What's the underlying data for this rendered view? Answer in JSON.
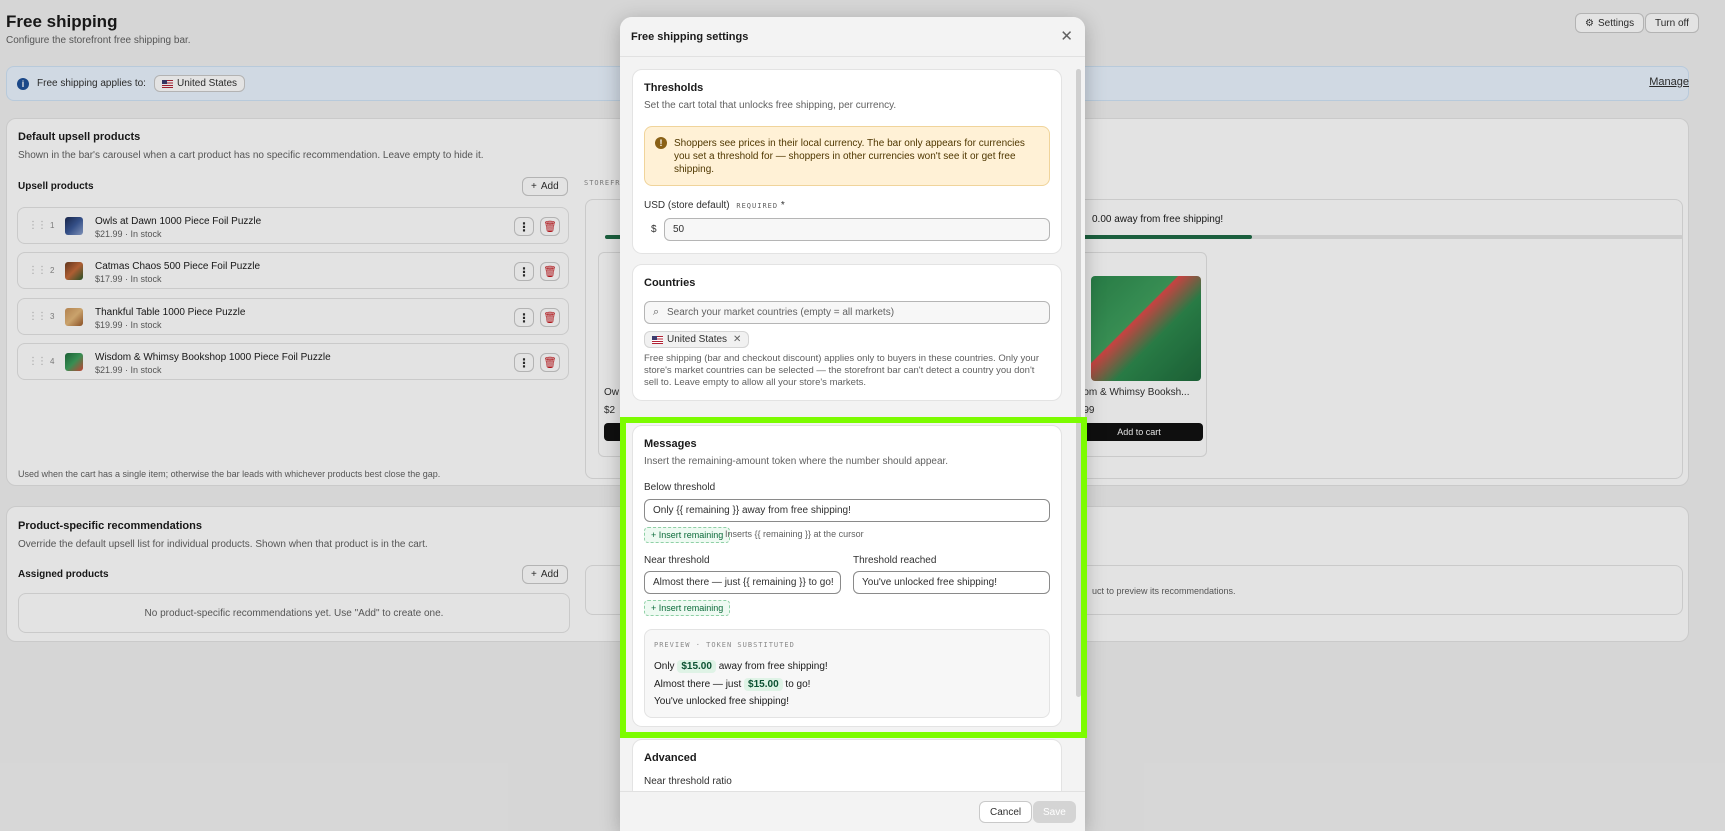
{
  "page": {
    "title": "Free shipping",
    "subtitle": "Configure the storefront free shipping bar.",
    "settings_label": "Settings",
    "turn_off_label": "Turn off"
  },
  "banner": {
    "text": "Free shipping applies to:",
    "country": "United States",
    "manage_label": "Manage"
  },
  "upsell": {
    "title": "Default upsell products",
    "subtitle": "Shown in the bar's carousel when a cart product has no specific recommendation. Leave empty to hide it.",
    "list_title": "Upsell products",
    "add_label": "Add",
    "footnote": "Used when the cart has a single item; otherwise the bar leads with whichever products best close the gap.",
    "products": [
      {
        "index": "1",
        "title": "Owls at Dawn 1000 Piece Foil Puzzle",
        "meta": "$21.99 · In stock"
      },
      {
        "index": "2",
        "title": "Catmas Chaos 500 Piece Foil Puzzle",
        "meta": "$17.99 · In stock"
      },
      {
        "index": "3",
        "title": "Thankful Table 1000 Piece Puzzle",
        "meta": "$19.99 · In stock"
      },
      {
        "index": "4",
        "title": "Wisdom & Whimsy Bookshop 1000 Piece Foil Puzzle",
        "meta": "$21.99 · In stock"
      }
    ]
  },
  "storefront_preview": {
    "label": "STOREFR",
    "bar_text": "0.00 away from free shipping!",
    "card_left_name": "Ow",
    "card_left_price": "$2",
    "card_right_name": "fdom & Whimsy Booksh...",
    "card_right_price": "1.99",
    "add_to_cart": "Add to cart"
  },
  "specific": {
    "title": "Product-specific recommendations",
    "subtitle": "Override the default upsell list for individual products. Shown when that product is in the cart.",
    "list_title": "Assigned products",
    "add_label": "Add",
    "empty_text": "No product-specific recommendations yet. Use \"Add\" to create one.",
    "right_text": "uct to preview its recommendations."
  },
  "modal": {
    "title": "Free shipping settings",
    "thresholds": {
      "title": "Thresholds",
      "subtitle": "Set the cart total that unlocks free shipping, per currency.",
      "warning": "Shoppers see prices in their local currency. The bar only appears for currencies you set a threshold for — shoppers in other currencies won't see it or get free shipping.",
      "usd_label": "USD (store default)",
      "required_label": "REQUIRED",
      "required_star": "*",
      "currency_symbol": "$",
      "usd_value": "50"
    },
    "countries": {
      "title": "Countries",
      "search_placeholder": "Search your market countries (empty = all markets)",
      "tag": "United States",
      "description": "Free shipping (bar and checkout discount) applies only to buyers in these countries. Only your store's market countries can be selected — the storefront bar can't detect a country you don't sell to. Leave empty to allow all your store's markets."
    },
    "messages": {
      "title": "Messages",
      "subtitle": "Insert the remaining-amount token where the number should appear.",
      "below_label": "Below threshold",
      "below_value": "Only {{ remaining }} away from free shipping!",
      "insert_label": "+ Insert remaining",
      "insert_hint": "Inserts {{ remaining }} at the cursor",
      "near_label": "Near threshold",
      "near_value": "Almost there — just {{ remaining }} to go!",
      "reached_label": "Threshold reached",
      "reached_value": "You've unlocked free shipping!",
      "preview_head": "PREVIEW · TOKEN SUBSTITUTED",
      "preview_amount": "$15.00",
      "preview_1_pre": "Only",
      "preview_1_post": "away from free shipping!",
      "preview_2_pre": "Almost there — just",
      "preview_2_post": "to go!",
      "preview_3": "You've unlocked free shipping!"
    },
    "advanced": {
      "title": "Advanced",
      "ratio_label": "Near threshold ratio"
    },
    "cancel_label": "Cancel",
    "save_label": "Save"
  },
  "colors": {
    "highlight": "#7cfc00",
    "progress": "#1f6b46",
    "danger": "#c4161c"
  }
}
